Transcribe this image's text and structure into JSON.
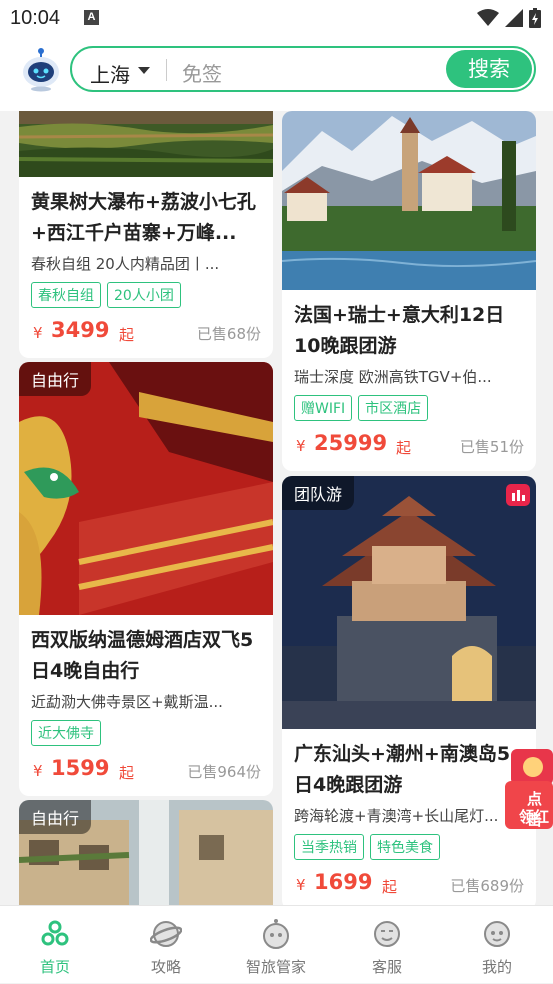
{
  "status": {
    "time": "10:04",
    "a_icon": "A"
  },
  "header": {
    "city": "上海",
    "search_placeholder": "免签",
    "search_button": "搜索"
  },
  "cards": [
    {
      "tag": "",
      "title": "黄果树大瀑布+荔波小七孔+西江千户苗寨+万峰...",
      "subtitle": "春秋自组 20人内精品团丨...",
      "tags": [
        "春秋自组",
        "20人小团"
      ],
      "currency": "¥",
      "price": "3499",
      "suffix": "起",
      "sold": "已售68份"
    },
    {
      "tag": "",
      "title": "法国+瑞士+意大利12日10晚跟团游",
      "subtitle": "瑞士深度 欧洲高铁TGV+伯...",
      "tags": [
        "赠WIFI",
        "市区酒店"
      ],
      "currency": "¥",
      "price": "25999",
      "suffix": "起",
      "sold": "已售51份"
    },
    {
      "tag": "自由行",
      "title": "西双版纳温德姆酒店双飞5日4晚自由行",
      "subtitle": "近勐泐大佛寺景区+戴斯温...",
      "tags": [
        "近大佛寺"
      ],
      "currency": "¥",
      "price": "1599",
      "suffix": "起",
      "sold": "已售964份"
    },
    {
      "tag": "团队游",
      "title": "广东汕头+潮州+南澳岛5日4晚跟团游",
      "subtitle": "跨海轮渡+青澳湾+长山尾灯...",
      "tags": [
        "当季热销",
        "特色美食"
      ],
      "currency": "¥",
      "price": "1699",
      "suffix": "起",
      "sold": "已售689份"
    },
    {
      "tag": "自由行"
    }
  ],
  "float_badge": {
    "line1": "点击",
    "line2": "领红"
  },
  "tabbar": {
    "items": [
      {
        "label": "首页",
        "icon": "home-icon",
        "active": true
      },
      {
        "label": "攻略",
        "icon": "planet-icon",
        "active": false
      },
      {
        "label": "智旅管家",
        "icon": "robot-icon",
        "active": false
      },
      {
        "label": "客服",
        "icon": "service-icon",
        "active": false
      },
      {
        "label": "我的",
        "icon": "profile-icon",
        "active": false
      }
    ]
  },
  "colors": {
    "brand": "#2ec27e",
    "price": "#f04a3a"
  }
}
